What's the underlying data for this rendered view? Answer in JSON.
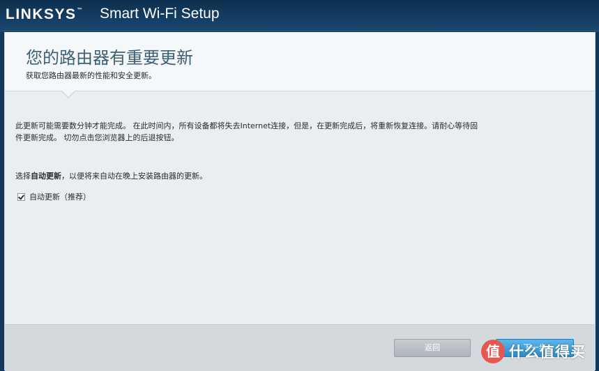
{
  "window": {
    "brand": "LINKSYS",
    "brand_tm": "™",
    "app_title": "Smart Wi-Fi Setup"
  },
  "header": {
    "title": "您的路由器有重要更新",
    "subtitle": "获取您路由器最新的性能和安全更新。"
  },
  "main": {
    "info_text": "此更新可能需要数分钟才能完成。 在此时间内，所有设备都将失去Internet连接，但是，在更新完成后，将重新恢复连接。请耐心等待固件更新完成。 切勿点击您浏览器上的后退按钮。",
    "auto_prefix": "选择",
    "auto_bold": "自动更新",
    "auto_suffix": "，以便将来自动在晚上安装路由器的更新。",
    "checkbox_label": "自动更新（推荐）",
    "checkbox_checked": true
  },
  "footer": {
    "back_label": "返回",
    "next_label": "下一步"
  },
  "watermark": {
    "glyph": "值",
    "text": "什么值得买"
  },
  "colors": {
    "topbar": "#13385c",
    "accent_button": "#3a97d4",
    "title_text": "#3f5f73"
  }
}
